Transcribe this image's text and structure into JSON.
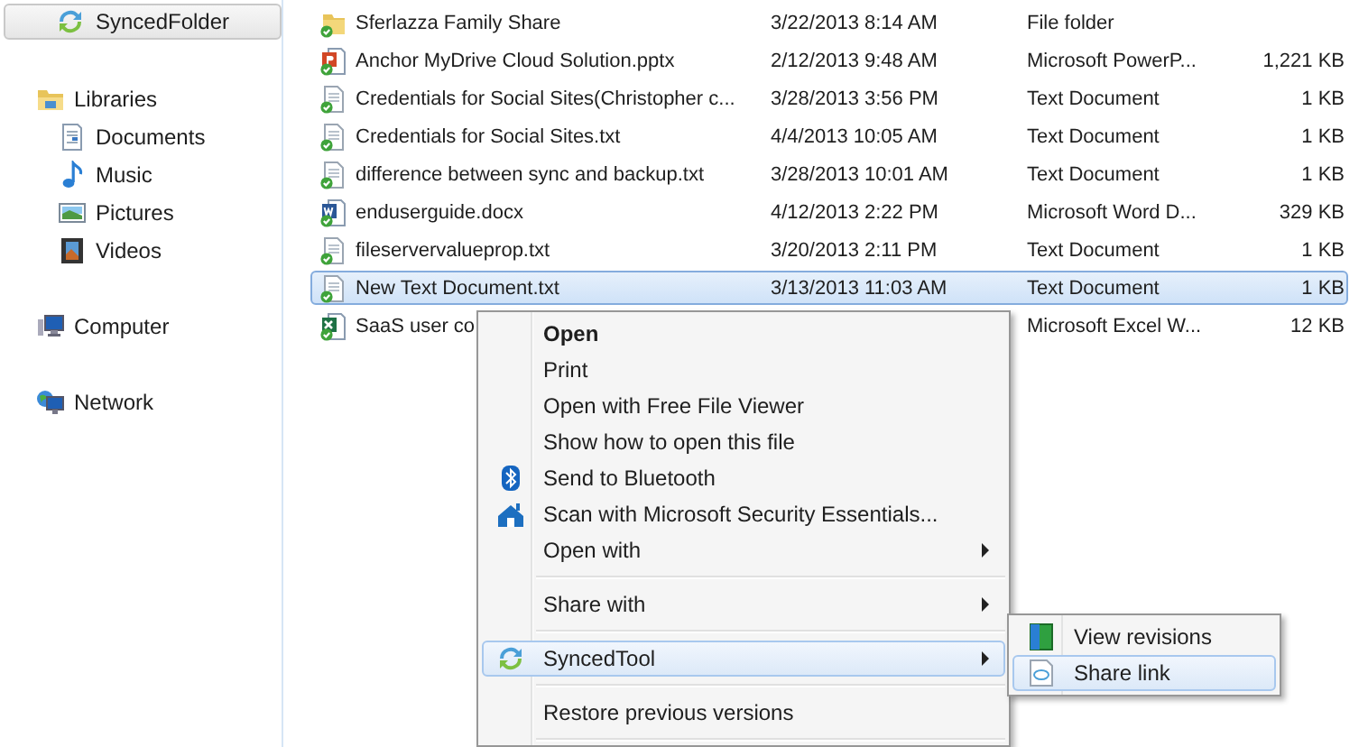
{
  "sidebar": {
    "top_button": "SyncedFolder",
    "groups": [
      {
        "label": "Libraries",
        "kind": "libraries",
        "children": [
          {
            "label": "Documents",
            "kind": "documents"
          },
          {
            "label": "Music",
            "kind": "music"
          },
          {
            "label": "Pictures",
            "kind": "pictures"
          },
          {
            "label": "Videos",
            "kind": "videos"
          }
        ]
      },
      {
        "label": "Computer",
        "kind": "computer"
      },
      {
        "label": "Network",
        "kind": "network"
      }
    ]
  },
  "files": [
    {
      "name": "Sferlazza Family Share",
      "date": "3/22/2013 8:14 AM",
      "type": "File folder",
      "kind": "folder",
      "selected": false
    },
    {
      "name": "Anchor MyDrive Cloud Solution.pptx",
      "date": "2/12/2013 9:48 AM",
      "type": "Microsoft PowerP...",
      "size": "1,221 KB",
      "kind": "pptx",
      "selected": false
    },
    {
      "name": "Credentials for Social Sites(Christopher c...",
      "date": "3/28/2013 3:56 PM",
      "type": "Text Document",
      "size": "1 KB",
      "kind": "text",
      "selected": false
    },
    {
      "name": "Credentials for Social Sites.txt",
      "date": "4/4/2013 10:05 AM",
      "type": "Text Document",
      "size": "1 KB",
      "kind": "text",
      "selected": false
    },
    {
      "name": "difference between sync and backup.txt",
      "date": "3/28/2013 10:01 AM",
      "type": "Text Document",
      "size": "1 KB",
      "kind": "text",
      "selected": false
    },
    {
      "name": "enduserguide.docx",
      "date": "4/12/2013 2:22 PM",
      "type": "Microsoft Word D...",
      "size": "329 KB",
      "kind": "docx",
      "selected": false
    },
    {
      "name": "fileservervalueprop.txt",
      "date": "3/20/2013 2:11 PM",
      "type": "Text Document",
      "size": "1 KB",
      "kind": "text",
      "selected": false
    },
    {
      "name": "New Text Document.txt",
      "date": "3/13/2013 11:03 AM",
      "type": "Text Document",
      "size": "1 KB",
      "kind": "text",
      "selected": true
    },
    {
      "name": "SaaS user co",
      "type": "Microsoft Excel W...",
      "size": "12 KB",
      "kind": "xlsx",
      "selected": false
    }
  ],
  "context_menu": {
    "items": [
      {
        "kind": "item",
        "label": "Open",
        "default": true,
        "submenu": false,
        "selected": false
      },
      {
        "kind": "item",
        "label": "Print",
        "default": false,
        "submenu": false,
        "selected": false
      },
      {
        "kind": "item",
        "label": "Open with Free File Viewer",
        "default": false,
        "submenu": false,
        "selected": false
      },
      {
        "kind": "item",
        "label": "Show how to open this file",
        "default": false,
        "submenu": false,
        "selected": false
      },
      {
        "kind": "bluetooth",
        "label": "Send to Bluetooth",
        "default": false,
        "submenu": false,
        "selected": false
      },
      {
        "kind": "security",
        "label": "Scan with Microsoft Security Essentials...",
        "default": false,
        "submenu": false,
        "selected": false
      },
      {
        "kind": "item",
        "label": "Open with",
        "default": false,
        "submenu": true,
        "selected": false
      },
      {
        "kind": "separator"
      },
      {
        "kind": "item",
        "label": "Share with",
        "default": false,
        "submenu": true,
        "selected": false
      },
      {
        "kind": "separator"
      },
      {
        "kind": "synced",
        "label": "SyncedTool",
        "default": false,
        "submenu": true,
        "selected": true
      },
      {
        "kind": "separator"
      },
      {
        "kind": "item",
        "label": "Restore previous versions",
        "default": false,
        "submenu": false,
        "selected": false
      },
      {
        "kind": "separator"
      }
    ]
  },
  "submenu": {
    "items": [
      {
        "kind": "revisions",
        "label": "View revisions",
        "selected": false
      },
      {
        "kind": "link",
        "label": "Share link",
        "selected": true
      }
    ]
  }
}
